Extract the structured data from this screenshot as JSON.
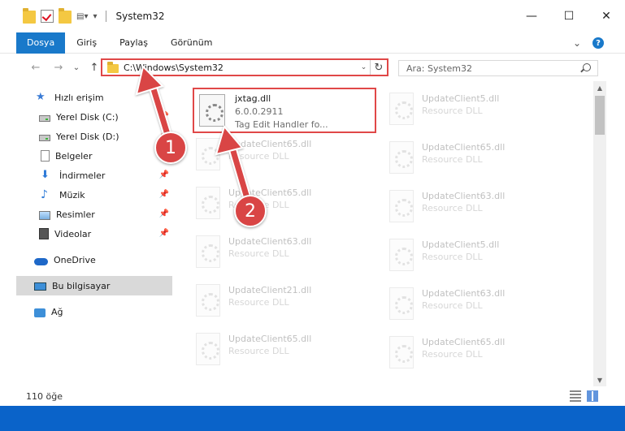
{
  "window": {
    "title": "System32",
    "minimize": "—",
    "maximize": "☐",
    "close": "✕"
  },
  "ribbon": {
    "tabs": [
      "Dosya",
      "Giriş",
      "Paylaş",
      "Görünüm"
    ],
    "expand": "⌄",
    "help": "?"
  },
  "nav": {
    "back": "←",
    "forward": "→",
    "recent": "⌄",
    "up": "↑",
    "address": "C:\\Windows\\System32",
    "address_dropdown": "⌄",
    "refresh": "↻",
    "search_placeholder": "Ara: System32"
  },
  "sidebar": {
    "items": [
      {
        "label": "Hızlı erişim",
        "icon": "star-icon"
      },
      {
        "label": "Yerel Disk (C:)",
        "icon": "drive-icon",
        "pinned": true
      },
      {
        "label": "Yerel Disk (D:)",
        "icon": "drive-icon",
        "pinned": true
      },
      {
        "label": "Belgeler",
        "icon": "document-icon",
        "pinned": true
      },
      {
        "label": "İndirmeler",
        "icon": "download-icon",
        "pinned": true
      },
      {
        "label": "Müzik",
        "icon": "music-icon",
        "pinned": true
      },
      {
        "label": "Resimler",
        "icon": "pictures-icon",
        "pinned": true
      },
      {
        "label": "Videolar",
        "icon": "video-icon",
        "pinned": true
      },
      {
        "label": "OneDrive",
        "icon": "cloud-icon"
      },
      {
        "label": "Bu bilgisayar",
        "icon": "computer-icon",
        "selected": true
      },
      {
        "label": "Ağ",
        "icon": "network-icon"
      }
    ],
    "pin_glyph": "📌"
  },
  "files": {
    "highlighted": {
      "name": "jxtag.dll",
      "version": "6.0.0.2911",
      "description": "Tag Edit Handler fo..."
    },
    "ghost": [
      {
        "name": "UpdateClient5.dll",
        "type": "Resource DLL"
      },
      {
        "name": "UpdateClient65.dll",
        "type": "Resource DLL"
      },
      {
        "name": "UpdateClient65.dll",
        "type": "Resource DLL"
      },
      {
        "name": "UpdateClient65.dll",
        "type": "Resource DLL"
      },
      {
        "name": "UpdateClient63.dll",
        "type": "Resource DLL"
      },
      {
        "name": "UpdateClient63.dll",
        "type": "Resource DLL"
      },
      {
        "name": "UpdateClient5.dll",
        "type": "Resource DLL"
      },
      {
        "name": "UpdateClient21.dll",
        "type": "Resource DLL"
      },
      {
        "name": "UpdateClient63.dll",
        "type": "Resource DLL"
      },
      {
        "name": "UpdateClient65.dll",
        "type": "Resource DLL"
      },
      {
        "name": "UpdateClient65.dll",
        "type": "Resource DLL"
      }
    ]
  },
  "status": {
    "count": "110 öğe"
  },
  "annotations": {
    "step1": "1",
    "step2": "2",
    "color": "#d94545"
  },
  "colors": {
    "accent": "#1979ca",
    "highlight_border": "#e04848",
    "taskbar": "#0a63c9"
  }
}
